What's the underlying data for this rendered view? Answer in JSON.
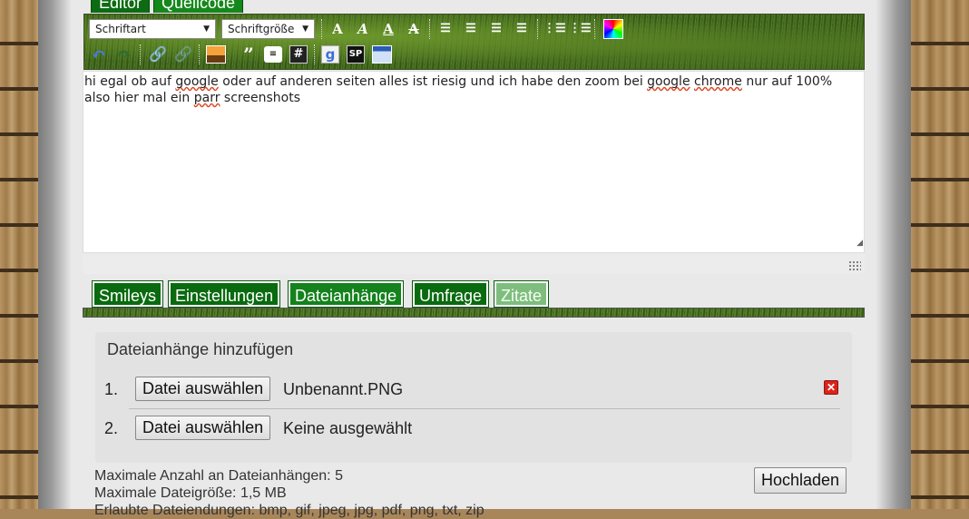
{
  "editor_tabs": [
    "Editor",
    "Quellcode"
  ],
  "toolbar": {
    "font_select": "Schriftart",
    "size_select": "Schriftgröße",
    "icons": [
      "bold-icon",
      "italic-icon",
      "underline-icon",
      "strikethrough-icon",
      "align-left-icon",
      "align-center-icon",
      "align-right-icon",
      "justify-icon",
      "bullet-list-icon",
      "numbered-list-icon",
      "color-picker-icon",
      "undo-icon",
      "redo-icon",
      "link-icon",
      "unlink-icon",
      "image-icon",
      "quote-icon",
      "comment-icon",
      "hash-icon",
      "google-icon",
      "sp-icon",
      "window-icon"
    ],
    "quote_glyph": "”",
    "hash_glyph": "#",
    "google_glyph": "g",
    "sp_glyph": "SP"
  },
  "editor": {
    "line1_parts": [
      "hi egal ob auf ",
      "google",
      " oder auf anderen seiten alles ist riesig und ich habe den zoom bei ",
      "google",
      " ",
      "chrome",
      " nur auf 100%"
    ],
    "line2_parts": [
      "also hier mal ein ",
      "parr",
      " screenshots"
    ]
  },
  "bottom_tabs": [
    "Smileys",
    "Einstellungen",
    "Dateianhänge",
    "Umfrage",
    "Zitate"
  ],
  "attachments": {
    "legend": "Dateianhänge hinzufügen",
    "rows": [
      {
        "num": "1.",
        "button": "Datei auswählen",
        "file": "Unbenannt.PNG"
      },
      {
        "num": "2.",
        "button": "Datei auswählen",
        "file": "Keine ausgewählt"
      }
    ],
    "max_count": "Maximale Anzahl an Dateianhängen: 5",
    "max_size": "Maximale Dateigröße: 1,5 MB",
    "allowed": "Erlaubte Dateiendungen: bmp, gif, jpeg, jpg, pdf, png, txt, zip",
    "upload_button": "Hochladen"
  },
  "colors": {
    "tab_green": "#0d6b13",
    "delete_red": "#d8241c"
  }
}
